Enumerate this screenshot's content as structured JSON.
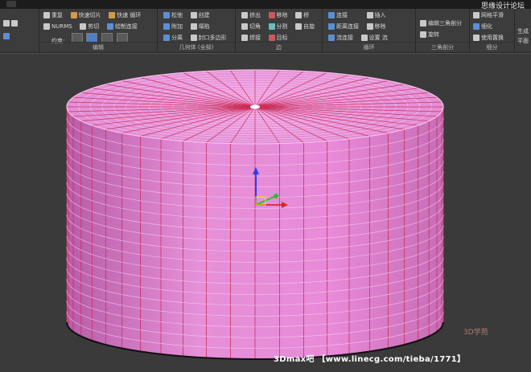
{
  "top_watermark": "思缘设计论坛",
  "ribbon": {
    "edit_group": {
      "label": "编辑",
      "items": [
        "重复",
        "快速切片",
        "快速 循环",
        "NURMS",
        "剪切",
        "绘制连接"
      ],
      "constraint_label": "约束:"
    },
    "geometry_group": {
      "label": "几何体 (全部)",
      "items": [
        "松弛",
        "创建",
        "附加",
        "塌陷",
        "分离",
        "封口多边形"
      ]
    },
    "edge_group": {
      "label": "边",
      "items": [
        "挤出",
        "移除",
        "桥",
        "切角",
        "分割",
        "焊接",
        "目标",
        "自旋"
      ]
    },
    "loop_group": {
      "label": "循环",
      "items": [
        "连接",
        "插入",
        "距离连接",
        "移除",
        "流连接",
        "设置 流"
      ]
    },
    "tri_group": {
      "label": "三角剖分",
      "items": [
        "编辑三角剖分",
        "旋转"
      ]
    },
    "subdiv_group": {
      "label": "细分",
      "items": [
        "网格平滑",
        "细化",
        "使用置换"
      ]
    },
    "extra_group": {
      "items": [
        "生成",
        "平面"
      ]
    }
  },
  "viewport": {
    "object": "cylinder-mesh",
    "colors": {
      "mesh": "#e88ad8",
      "wire": "#c8305a",
      "background": "#3a3a3a"
    }
  },
  "footer": {
    "caption": "3Dmax吧 【www.linecg.com/tieba/1771】"
  },
  "logo_watermark": "3D学苑"
}
